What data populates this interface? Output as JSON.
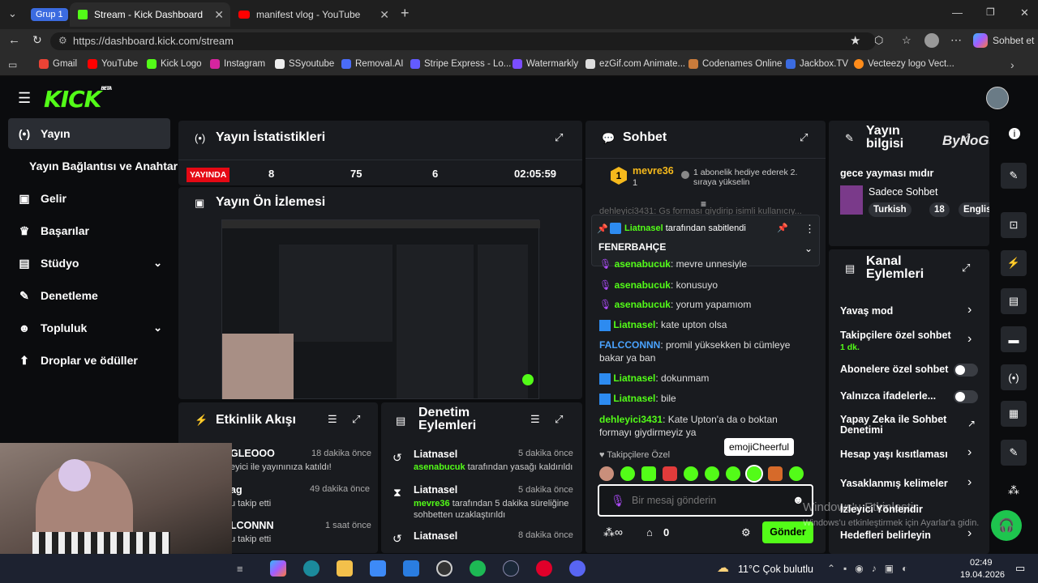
{
  "browser": {
    "group_label": "Grup 1",
    "tabs": [
      {
        "title": "Stream - Kick Dashboard"
      },
      {
        "title": "manifest vlog - YouTube"
      }
    ],
    "url": "https://dashboard.kick.com/stream",
    "copilot_label": "Sohbet et",
    "bookmarks": [
      "Gmail",
      "YouTube",
      "Kick Logo",
      "Instagram",
      "SSyoutube",
      "Removal.AI",
      "Stripe Express - Lo...",
      "Watermarkly",
      "ezGif.com Animate...",
      "Codenames Online",
      "Jackbox.TV",
      "Vecteezy logo Vect..."
    ]
  },
  "kick": {
    "logo": "KICK",
    "logo_sup": "BETA",
    "sidebar": [
      {
        "label": "Yayın",
        "icon": "broadcast-icon"
      },
      {
        "label": "Yayın Bağlantısı ve Anahtarı",
        "icon": ""
      },
      {
        "label": "Gelir",
        "icon": "income-icon"
      },
      {
        "label": "Başarılar",
        "icon": "trophy-icon"
      },
      {
        "label": "Stüdyo",
        "icon": "studio-icon"
      },
      {
        "label": "Denetleme",
        "icon": "wrench-icon"
      },
      {
        "label": "Topluluk",
        "icon": "community-icon"
      },
      {
        "label": "Droplar ve ödüller",
        "icon": "drops-icon"
      }
    ],
    "stats": {
      "title": "Yayın İstatistikleri",
      "live": "YAYINDA",
      "v1": "8",
      "v2": "75",
      "v3": "6",
      "time": "02:05:59"
    },
    "preview": {
      "title": "Yayın Ön İzlemesi"
    },
    "activity": {
      "title": "Etkinlik Akışı",
      "items": [
        {
          "name": "GLEOOO",
          "time": "18 dakika önce",
          "desc": "eyici ile yayınınıza katıldı!"
        },
        {
          "name": "ag",
          "time": "49 dakika önce",
          "desc": "u takip etti"
        },
        {
          "name": "LCONNN",
          "time": "1 saat önce",
          "desc": "u takip etti"
        }
      ]
    },
    "moderation": {
      "title": "Denetim Eylemleri",
      "items": [
        {
          "name": "Liatnasel",
          "time": "5 dakika önce",
          "target": "asenabucuk",
          "desc": " tarafından yasağı kaldırıldı"
        },
        {
          "name": "Liatnasel",
          "time": "5 dakika önce",
          "target": "mevre36",
          "desc": " tarafından 5 dakika süreliğine sohbetten uzaklaştırıldı"
        },
        {
          "name": "Liatnasel",
          "time": "8 dakika önce",
          "target": "",
          "desc": ""
        }
      ]
    },
    "chat": {
      "title": "Sohbet",
      "top_user": "mevre36",
      "top_rank": "1",
      "top_count": "1",
      "top_note": "1 abonelik hediye ederek 2. sıraya yükselin",
      "faded": "dehleyici3431: Gs forması giydirip isimli kullanıcıy...",
      "pinned_by": "Liatnasel",
      "pinned_suffix": " tarafından sabitlendi",
      "pinned_msg": "FENERBAHÇE",
      "messages": [
        {
          "user": "asenabucuk",
          "text": "mevre unnesiyle",
          "color": "#b04cff"
        },
        {
          "user": "asenabucuk",
          "text": "konusuyo",
          "color": "#b04cff"
        },
        {
          "user": "asenabucuk",
          "text": "yorum yapamıom",
          "color": "#b04cff"
        },
        {
          "user": "Liatnasel",
          "text": "kate upton olsa",
          "color": "#53fc18"
        },
        {
          "user": "FALCCONNN",
          "text": "promil yüksekken bi cümleye bakar ya ban",
          "color": "#4aa3ff"
        },
        {
          "user": "Liatnasel",
          "text": "dokunmam",
          "color": "#53fc18"
        },
        {
          "user": "Liatnasel",
          "text": "bile",
          "color": "#53fc18"
        },
        {
          "user": "dehleyici3431",
          "text": "Kate Upton'a da o boktan formayı giydirmeyiz ya",
          "color": "#53fc18"
        }
      ],
      "followers_label": "Takipçilere Özel",
      "tooltip": "emojiCheerful",
      "placeholder": "Bir mesaj gönderin",
      "count": "0",
      "send": "Gönder"
    },
    "info": {
      "title": "Yayın bilgisi",
      "watermark": "ByNoGame",
      "stream_title": "gece yayması mıdır",
      "category": "Sadece Sohbet",
      "tags": [
        "Turkish",
        "18",
        "English"
      ]
    },
    "channel": {
      "title": "Kanal Eylemleri",
      "rows": [
        {
          "label": "Yavaş mod",
          "type": "chevron"
        },
        {
          "label": "Takipçilere özel sohbet",
          "sub": "1 dk.",
          "type": "chevron"
        },
        {
          "label": "Abonelere özel sohbet",
          "type": "toggle"
        },
        {
          "label": "Yalnızca ifadelerle...",
          "type": "toggle"
        },
        {
          "label": "Yapay Zeka ile Sohbet Denetimi",
          "type": "external"
        },
        {
          "label": "Hesap yaşı kısıtlaması",
          "type": "chevron"
        },
        {
          "label": "Yasaklanmış kelimeler",
          "type": "chevron"
        },
        {
          "label": "İzleyici Yönlendir",
          "type": ""
        },
        {
          "label": "Hedefleri belirleyin",
          "type": "chevron"
        }
      ]
    },
    "activate_windows": {
      "line1": "Windows'u Etkinleştir",
      "line2": "Windows'u etkinleştirmek için Ayarlar'a gidin."
    }
  },
  "taskbar": {
    "weather": "11°C Çok bulutlu",
    "time": "02:49",
    "date": "19.04.2026"
  },
  "colors": {
    "accent": "#53fc18",
    "live": "#e50914",
    "panel": "#191b1f"
  }
}
